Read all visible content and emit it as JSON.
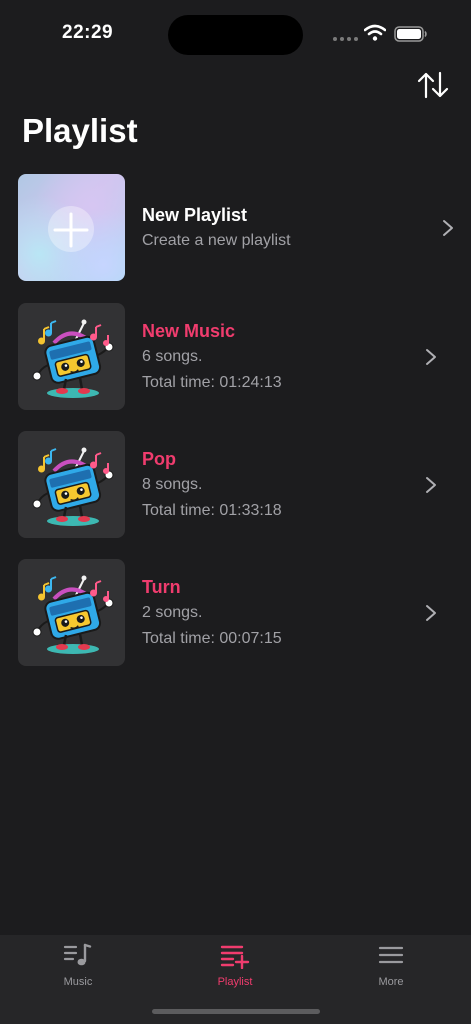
{
  "status_bar": {
    "time": "22:29"
  },
  "page": {
    "title": "Playlist"
  },
  "new_playlist": {
    "title": "New Playlist",
    "subtitle": "Create a new playlist"
  },
  "playlists": [
    {
      "name": "New Music",
      "songs": "6 songs.",
      "total_time": "Total time: 01:24:13"
    },
    {
      "name": "Pop",
      "songs": "8 songs.",
      "total_time": "Total time: 01:33:18"
    },
    {
      "name": "Turn",
      "songs": "2 songs.",
      "total_time": "Total time: 00:07:15"
    }
  ],
  "tabs": [
    {
      "label": "Music",
      "icon": "music-list-icon",
      "active": false
    },
    {
      "label": "Playlist",
      "icon": "playlist-add-icon",
      "active": true
    },
    {
      "label": "More",
      "icon": "menu-icon",
      "active": false
    }
  ],
  "colors": {
    "background": "#1c1c1e",
    "accent": "#f03c6e",
    "secondary_text": "#a1a1a6",
    "tab_bar": "#262628"
  }
}
